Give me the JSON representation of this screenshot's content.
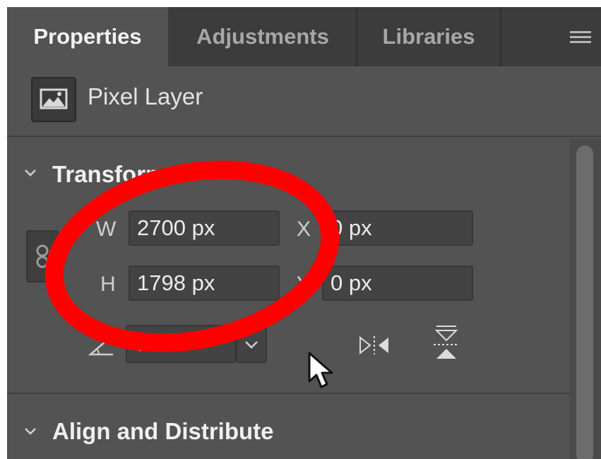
{
  "tabs": [
    {
      "label": "Properties",
      "active": true
    },
    {
      "label": "Adjustments",
      "active": false
    },
    {
      "label": "Libraries",
      "active": false
    }
  ],
  "layer": {
    "label": "Pixel Layer",
    "icon": "image-icon"
  },
  "transform": {
    "title": "Transform",
    "w_label": "W",
    "w_value": "2700 px",
    "h_label": "H",
    "h_value": "1798 px",
    "x_label": "X",
    "x_value": "0 px",
    "y_label": "Y",
    "y_value": "0 px",
    "angle_value": "0.00°"
  },
  "align": {
    "title": "Align and Distribute"
  },
  "colors": {
    "panel": "#535353",
    "tabbar": "#3c3c3c",
    "annotation": "#ff0000"
  }
}
